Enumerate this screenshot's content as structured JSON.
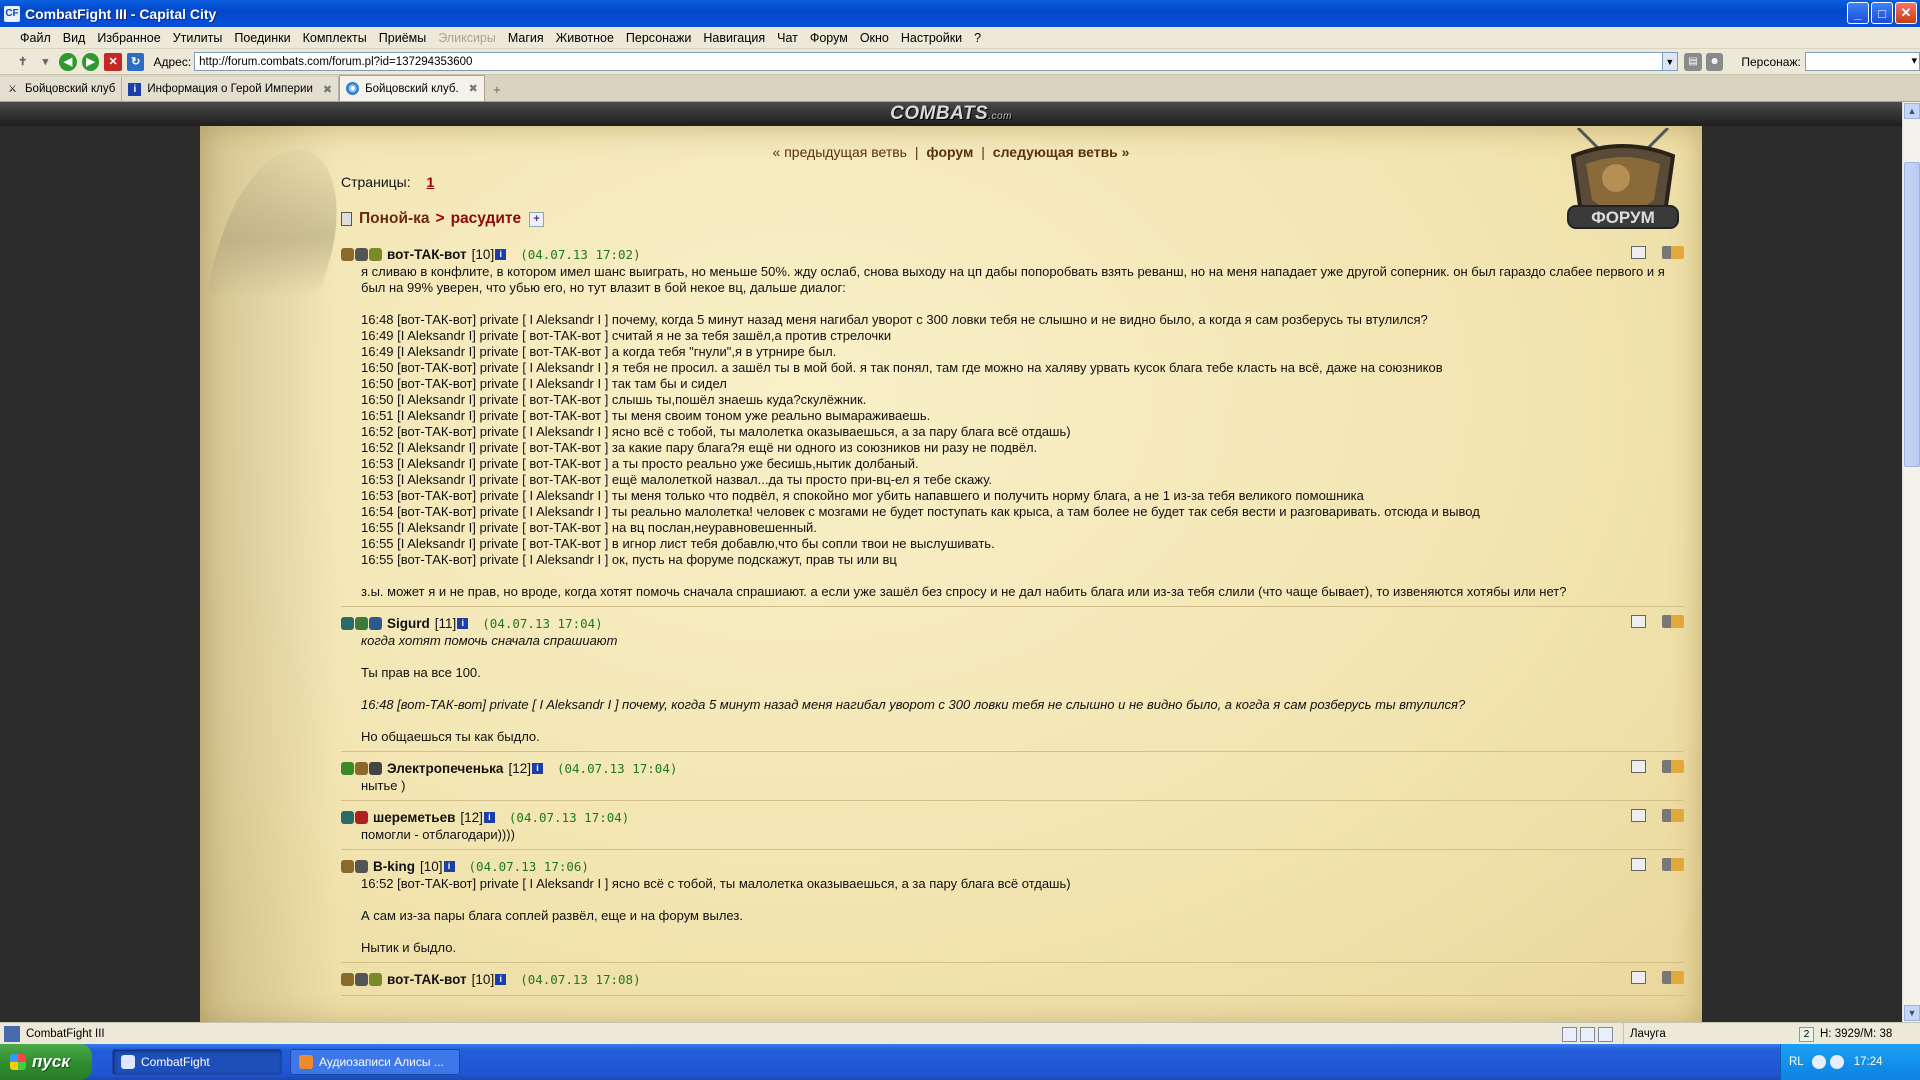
{
  "window": {
    "title": "CombatFight III - Capital City",
    "app_icon": "CF"
  },
  "menu": [
    "Файл",
    "Вид",
    "Избранное",
    "Утилиты",
    "Поединки",
    "Комплекты",
    "Приёмы",
    "Эликсиры",
    "Магия",
    "Животное",
    "Персонажи",
    "Навигация",
    "Чат",
    "Форум",
    "Окно",
    "Настройки",
    "?"
  ],
  "menu_disabled": "Эликсиры",
  "address": {
    "label": "Адрес:",
    "url": "http://forum.combats.com/forum.pl?id=137294353600",
    "persona_label": "Персонаж:"
  },
  "tabs": [
    {
      "label": "Бойцовский клуб",
      "icon": "swords-icon"
    },
    {
      "label": "Информация о Герой Империи",
      "icon": "info-icon"
    },
    {
      "label": "Бойцовский клуб.",
      "icon": "globe-icon",
      "active": true
    }
  ],
  "banner": {
    "logo": "COMBATS",
    "logo_suffix": ".com"
  },
  "forum": {
    "badge_text": "ФОРУМ",
    "nav_prev": "« предыдущая ветвь",
    "nav_forum": "форум",
    "nav_next": "следующая ветвь »",
    "pages_label": "Страницы:",
    "page_num": "1",
    "crumb_section": "Поной-ка",
    "crumb_arrow": ">",
    "crumb_topic": "расудите",
    "star": "+"
  },
  "posts": [
    {
      "author": "вот-ТАК-вот",
      "level": "[10]",
      "date": "(04.07.13 17:02)",
      "badges": [
        "#8a6a2a",
        "#555",
        "#7a8a2a"
      ],
      "lines": [
        {
          "t": "я сливаю в конфлите, в котором имел шанс выиграть, но меньше 50%. жду ослаб, снова выходу на цп дабы попоробвать взять реванш, но на меня нападает уже другой соперник. он был гараздо слабее первого и я был на 99% уверен, что убью его, но тут влазит в бой некое вц, дальше диалог:"
        },
        {
          "t": ""
        },
        {
          "t": "16:48 [вот-ТАК-вот] private [ I Aleksandr I ] почему, когда 5 минут назад меня нагибал уворот с 300 ловки тебя не слышно и не видно было, а когда я сам розберусь ты втулился?"
        },
        {
          "t": "16:49 [I Aleksandr I] private [ вот-ТАК-вот ] считай я не за тебя зашёл,а против стрелочки"
        },
        {
          "t": "16:49 [I Aleksandr I] private [ вот-ТАК-вот ] а когда тебя \"гнули\",я в утрнире был."
        },
        {
          "t": "16:50 [вот-ТАК-вот] private [ I Aleksandr I ] я тебя не просил. а зашёл ты в мой бой. я так понял, там где можно на халяву урвать кусок блага тебе класть на всё, даже на союзников"
        },
        {
          "t": "16:50 [вот-ТАК-вот] private [ I Aleksandr I ] так там бы и сидел"
        },
        {
          "t": "16:50 [I Aleksandr I] private [ вот-ТАК-вот ] слышь ты,пошёл знаешь куда?скулёжник."
        },
        {
          "t": "16:51 [I Aleksandr I] private [ вот-ТАК-вот ] ты меня своим тоном уже реально вымараживаешь."
        },
        {
          "t": "16:52 [вот-ТАК-вот] private [ I Aleksandr I ] ясно всё с тобой, ты малолетка оказываешься, а за пару блага всё отдашь)"
        },
        {
          "t": "16:52 [I Aleksandr I] private [ вот-ТАК-вот ] за какие пару блага?я ещё ни одного из союзников ни разу не подвёл."
        },
        {
          "t": "16:53 [I Aleksandr I] private [ вот-ТАК-вот ] а ты просто реально уже бесишь,нытик долбаный."
        },
        {
          "t": "16:53 [I Aleksandr I] private [ вот-ТАК-вот ] ещё малолеткой назвал...да ты просто при-вц-ел я тебе скажу."
        },
        {
          "t": "16:53 [вот-ТАК-вот] private [ I Aleksandr I ] ты меня только что подвёл, я спокойно мог убить напавшего и получить норму блага, а не 1 из-за тебя великого помошника"
        },
        {
          "t": "16:54 [вот-ТАК-вот] private [ I Aleksandr I ] ты реально малолетка! человек с мозгами не будет поступать как крыса, а там более не будет так себя вести и разговаривать. отсюда и вывод"
        },
        {
          "t": "16:55 [I Aleksandr I] private [ вот-ТАК-вот ] на вц послан,неуравновешенный."
        },
        {
          "t": "16:55 [I Aleksandr I] private [ вот-ТАК-вот ] в игнор лист тебя добавлю,что бы сопли твои не выслушивать."
        },
        {
          "t": "16:55 [вот-ТАК-вот] private [ I Aleksandr I ] ок, пусть на форуме подскажут, прав ты или вц"
        },
        {
          "t": ""
        },
        {
          "t": "з.ы. может я и не прав, но вроде, когда хотят помочь сначала спрашиают. а если уже зашёл без спросу и не дал набить блага или из-за тебя слили (что чаще бывает), то извеняются хотябы или нет?"
        }
      ]
    },
    {
      "author": "Sigurd",
      "level": "[11]",
      "date": "(04.07.13 17:04)",
      "badges": [
        "#2a6a6a",
        "#3a7a3a",
        "#2a5a8a"
      ],
      "lines": [
        {
          "t": "когда хотят помочь сначала спрашиают",
          "q": true
        },
        {
          "t": ""
        },
        {
          "t": "Ты прав на все 100."
        },
        {
          "t": ""
        },
        {
          "t": "16:48 [вот-ТАК-вот] private [ I Aleksandr I ] почему, когда 5 минут назад меня нагибал уворот с 300 ловки тебя не слышно и не видно было, а когда я сам розберусь ты втулился?",
          "q": true
        },
        {
          "t": ""
        },
        {
          "t": "Но общаешься ты как быдло."
        }
      ]
    },
    {
      "author": "Электропеченька",
      "level": "[12]",
      "date": "(04.07.13 17:04)",
      "badges": [
        "#3a8a2a",
        "#8a6a2a",
        "#444"
      ],
      "lines": [
        {
          "t": "нытье )"
        }
      ]
    },
    {
      "author": "шереметьев",
      "level": "[12]",
      "date": "(04.07.13 17:04)",
      "badges": [
        "#2a6a6a",
        "#b02020"
      ],
      "lines": [
        {
          "t": "помогли - отблагодари))))"
        }
      ]
    },
    {
      "author": "B-king",
      "level": "[10]",
      "date": "(04.07.13 17:06)",
      "badges": [
        "#8a6a2a",
        "#555"
      ],
      "lines": [
        {
          "t": "16:52 [вот-ТАК-вот] private [ I Aleksandr I ] ясно всё с тобой, ты малолетка оказываешься, а за пару блага всё отдашь)"
        },
        {
          "t": ""
        },
        {
          "t": "А сам из-за пары блага соплей развёл, еще и на форум вылез."
        },
        {
          "t": ""
        },
        {
          "t": "Нытик и быдло."
        }
      ]
    },
    {
      "author": "вот-ТАК-вот",
      "level": "[10]",
      "date": "(04.07.13 17:08)",
      "badges": [
        "#8a6a2a",
        "#555",
        "#7a8a2a"
      ],
      "lines": []
    }
  ],
  "status": {
    "left": "CombatFight III",
    "persona": "Лачуга",
    "num": "2",
    "hp": "H: 3929/M: 38"
  },
  "taskbar": {
    "start": "пуск",
    "items": [
      {
        "label": "CombatFight",
        "active": true
      },
      {
        "label": "Аудиозаписи Алисы ...",
        "active": false
      }
    ],
    "lang": "RL",
    "time": "17:24"
  }
}
